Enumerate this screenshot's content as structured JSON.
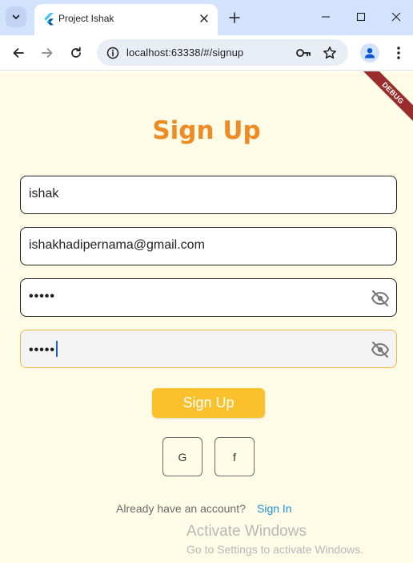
{
  "browser": {
    "tab_title": "Project Ishak",
    "url": "localhost:63338/#/signup"
  },
  "debug_banner": "DEBUG",
  "page": {
    "title": "Sign Up",
    "fields": {
      "name_value": "ishak",
      "email_value": "ishakhadipernama@gmail.com",
      "password_masked": "•••••",
      "confirm_password_masked": "•••••"
    },
    "signup_button": "Sign Up",
    "google_button": "G",
    "facebook_button": "f",
    "footer": {
      "prompt": "Already have an account?",
      "link": "Sign In"
    }
  },
  "watermark": {
    "title": "Activate Windows",
    "subtitle": "Go to Settings to activate Windows."
  },
  "colors": {
    "tabbar_bg": "#d3e3fd",
    "page_bg": "#fefbe7",
    "title_orange": "#ee8b25",
    "button_yellow": "#fbc12d",
    "link_blue": "#1a8fdc",
    "debug_red": "#9b2c2c"
  },
  "icons": {
    "tab_menu": "chevron-down-icon",
    "favicon": "flutter-icon",
    "close": "close-icon",
    "new_tab": "plus-icon",
    "back": "arrow-left-icon",
    "forward": "arrow-right-icon",
    "reload": "reload-icon",
    "info": "info-icon",
    "key": "key-icon",
    "star": "star-icon",
    "profile": "person-icon",
    "menu": "kebab-icon",
    "visibility": "eye-off-icon"
  }
}
